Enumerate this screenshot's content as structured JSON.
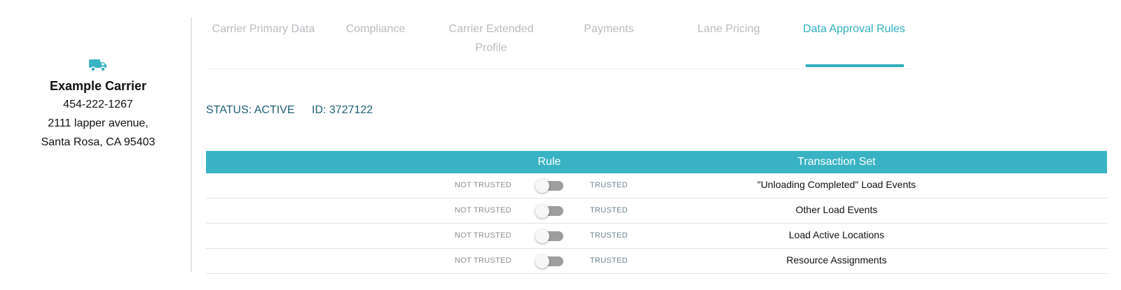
{
  "carrier": {
    "icon": "truck-icon",
    "name": "Example Carrier",
    "phone": "454-222-1267",
    "address_line1": "2111 lapper avenue,",
    "address_line2": "Santa Rosa, CA 95403"
  },
  "tabs": [
    {
      "line1": "Carrier Primary Data",
      "line2": ""
    },
    {
      "line1": "Compliance",
      "line2": ""
    },
    {
      "line1": "Carrier Extended",
      "line2": "Profile"
    },
    {
      "line1": "Payments",
      "line2": ""
    },
    {
      "line1": "Lane Pricing",
      "line2": ""
    },
    {
      "line1": "Data Approval Rules",
      "line2": "",
      "active": true
    }
  ],
  "status": {
    "status_text": "STATUS: ACTIVE",
    "id_text": "ID: 3727122"
  },
  "table": {
    "headers": {
      "rule": "Rule",
      "transaction_set": "Transaction Set"
    },
    "rows": [
      {
        "not_trusted": "NOT TRUSTED",
        "trusted": "TRUSTED",
        "toggle_on": false,
        "set": "\"Unloading Completed\" Load Events"
      },
      {
        "not_trusted": "NOT TRUSTED",
        "trusted": "TRUSTED",
        "toggle_on": false,
        "set": "Other Load Events"
      },
      {
        "not_trusted": "NOT TRUSTED",
        "trusted": "TRUSTED",
        "toggle_on": false,
        "set": "Load Active Locations"
      },
      {
        "not_trusted": "NOT TRUSTED",
        "trusted": "TRUSTED",
        "toggle_on": false,
        "set": "Resource Assignments"
      }
    ]
  },
  "colors": {
    "accent": "#39b3c3",
    "status_text": "#1c5f73",
    "inactive_tab": "#b9bcc0",
    "toggle_off": "#9e9e9e"
  }
}
